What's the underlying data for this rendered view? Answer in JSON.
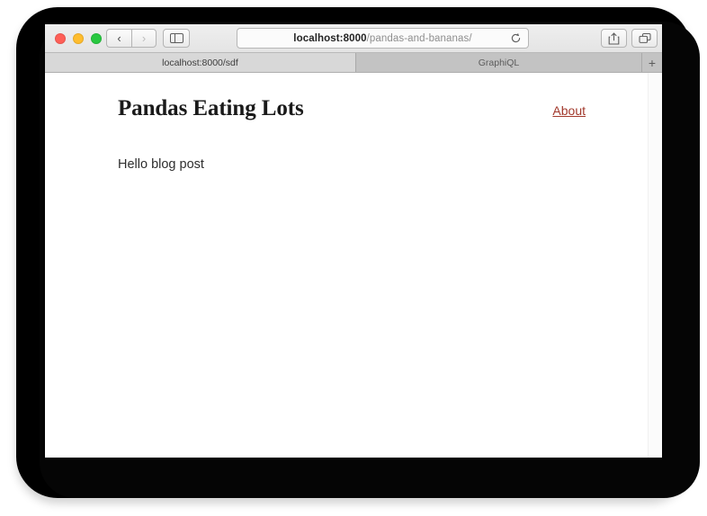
{
  "browser": {
    "window_controls": {
      "close_label": "Close",
      "minimize_label": "Minimize",
      "maximize_label": "Maximize",
      "close_color": "#ff5f57",
      "minimize_color": "#ffbd2e",
      "maximize_color": "#28c840"
    },
    "nav": {
      "back_glyph": "‹",
      "forward_glyph": "›",
      "back_enabled": "true",
      "forward_enabled": "false"
    },
    "address_bar": {
      "host": "localhost:8000",
      "path": "/pandas-and-bananas/",
      "full_url": "localhost:8000/pandas-and-bananas/",
      "reload_glyph": "↻"
    },
    "toolbar_icons": {
      "sidebar": "sidebar-icon",
      "share": "share-icon",
      "tab_overview": "tab-overview-icon"
    },
    "tabs": [
      {
        "label": "localhost:8000/sdf",
        "active": "true"
      },
      {
        "label": "GraphiQL",
        "active": "false"
      }
    ],
    "new_tab_glyph": "+"
  },
  "page": {
    "site_title": "Pandas Eating Lots",
    "nav_link": "About",
    "body_text": "Hello blog post",
    "link_color": "#a2392c",
    "title_color": "#1a1a1a",
    "body_color": "#2e2e2e",
    "background_color": "#ffffff"
  }
}
